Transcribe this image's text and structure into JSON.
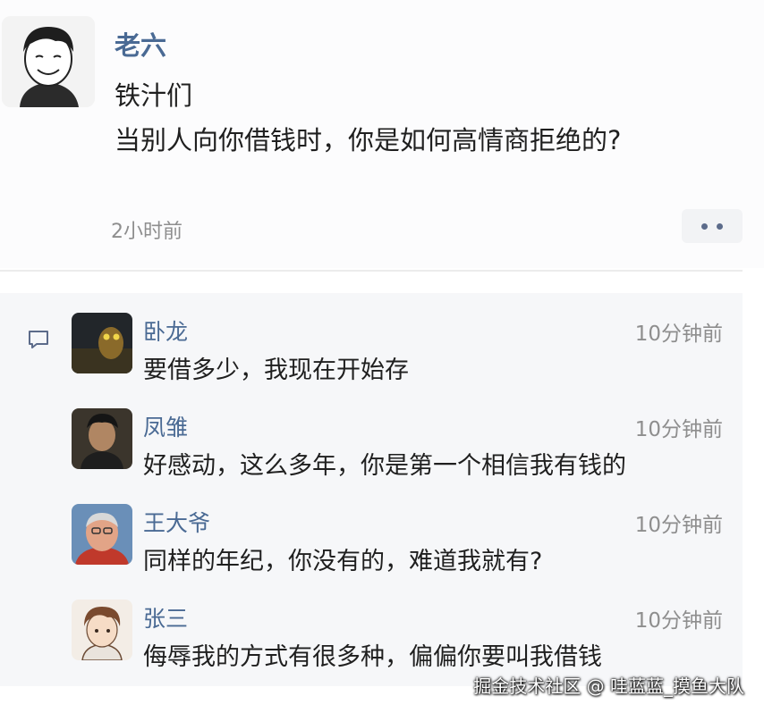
{
  "post": {
    "author": "老六",
    "line1": "铁汁们",
    "line2": "当别人向你借钱时，你是如何高情商拒绝的?",
    "time": "2小时前"
  },
  "comments": [
    {
      "name": "卧龙",
      "time": "10分钟前",
      "text": "要借多少，我现在开始存"
    },
    {
      "name": "凤雏",
      "time": "10分钟前",
      "text": "好感动，这么多年，你是第一个相信我有钱的"
    },
    {
      "name": "王大爷",
      "time": "10分钟前",
      "text": "同样的年纪，你没有的，难道我就有?"
    },
    {
      "name": "张三",
      "time": "10分钟前",
      "text": "侮辱我的方式有很多种，偏偏你要叫我借钱"
    }
  ],
  "watermark": "掘金技术社区 @ 哇蓝蓝_摸鱼大队",
  "colors": {
    "name": "#4a6a94",
    "time": "#8e8e8e",
    "text": "#1f1f1f"
  }
}
